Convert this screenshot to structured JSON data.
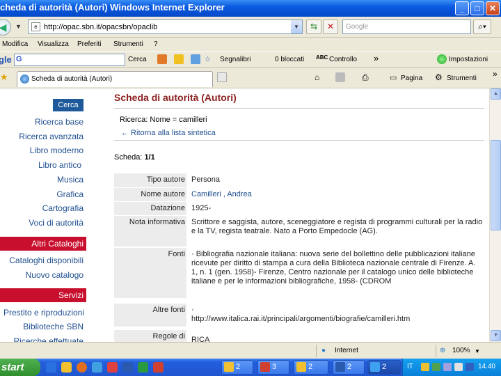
{
  "window": {
    "title": "Scheda di autorità (Autori) - Windows Internet Explorer",
    "title_visible": "cheda di autorità (Autori)   Windows Internet Explorer"
  },
  "address": {
    "url": "http://opac.sbn.it/opacsbn/opaclib",
    "search_placeholder": "Google"
  },
  "menu": {
    "items": [
      "Modifica",
      "Visualizza",
      "Preferiti",
      "Strumenti",
      "?"
    ]
  },
  "google_bar": {
    "cerca": "Cerca",
    "segnalibri": "Segnalibri",
    "bloccati": "0 bloccati",
    "controllo": "Controllo",
    "more": "»",
    "impostazioni": "Impostazioni"
  },
  "tab": {
    "label": "Scheda di autorità (Autori)",
    "pagina": "Pagina",
    "strumenti": "Strumenti"
  },
  "sidebar": {
    "search_button": "Cerca",
    "links_top": [
      "Ricerca base",
      "Ricerca avanzata",
      "Libro moderno",
      "Libro antico",
      "Musica",
      "Grafica",
      "Cartografia",
      "Voci di autorità"
    ],
    "section_cataloghi": "Altri Cataloghi",
    "links_cataloghi": [
      "Cataloghi disponibili",
      "Nuovo catalogo"
    ],
    "section_servizi": "Servizi",
    "links_servizi": [
      "Prestito e riproduzioni",
      "Biblioteche SBN",
      "Ricerche effettuate"
    ]
  },
  "main": {
    "title": "Scheda di autorità (Autori)",
    "query": "Ricerca: Nome = camilleri",
    "back_link": "← Ritorna alla lista sintetica",
    "scheda_label": "Scheda:",
    "scheda_value": "1/1",
    "rows": [
      {
        "label": "Tipo autore",
        "value": "Persona"
      },
      {
        "label": "Nome autore",
        "value": "Camilleri , Andrea"
      },
      {
        "label": "Datazione",
        "value": "1925-"
      },
      {
        "label": "Nota informativa",
        "value": "Scrittore e saggista, autore, sceneggiatore e regista di programmi culturali per la radio e la TV, regista teatrale. Nato a Porto Empedocle (AG)."
      },
      {
        "label": "Fonti",
        "value": "· Bibliografia nazionale italiana: nuova serie del bollettino delle pubblicazioni italiane ricevute per diritto di stampa a cura della Biblioteca nazionale centrale di Firenze. A. 1, n. 1 (gen. 1958)- Firenze, Centro nazionale per il catalogo unico delle biblioteche italiane e per le informazioni bibliografiche, 1958- (CDROM"
      },
      {
        "label": "Altre fonti",
        "value": "·\nhttp://www.italica.rai.it/principali/argomenti/biografie/camilleri.htm"
      },
      {
        "label": "Regole di",
        "value": "RICA"
      }
    ]
  },
  "status": {
    "zone": "Internet",
    "zoom": "100%"
  },
  "taskbar": {
    "start": "start",
    "tasks": [
      "2",
      "3",
      "2",
      "2",
      "2"
    ],
    "lang": "IT",
    "clock": "14.40"
  },
  "colors": {
    "accent_red": "#c8102e",
    "link_blue": "#1f4f8f",
    "title_red": "#8b2020"
  }
}
